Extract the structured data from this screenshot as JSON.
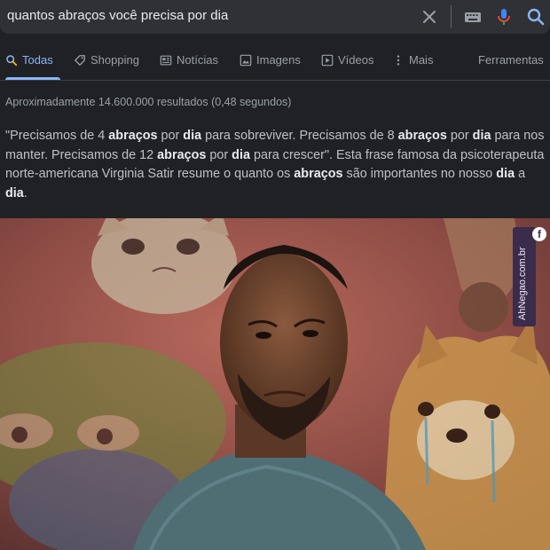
{
  "search": {
    "query": "quantos abraços você precisa por dia"
  },
  "tabs": [
    {
      "label": "Todas",
      "icon": "search-icon",
      "active": true
    },
    {
      "label": "Shopping",
      "icon": "tag-icon",
      "active": false
    },
    {
      "label": "Notícias",
      "icon": "news-icon",
      "active": false
    },
    {
      "label": "Imagens",
      "icon": "image-icon",
      "active": false
    },
    {
      "label": "Vídeos",
      "icon": "video-icon",
      "active": false
    },
    {
      "label": "Mais",
      "icon": "more-icon",
      "active": false
    }
  ],
  "tools_label": "Ferramentas",
  "result_stats": "Aproximadamente 14.600.000 resultados (0,48 segundos)",
  "snippet": [
    {
      "text": "\"Precisamos de 4 ",
      "bold": false
    },
    {
      "text": "abraços",
      "bold": true
    },
    {
      "text": " por ",
      "bold": false
    },
    {
      "text": "dia",
      "bold": true
    },
    {
      "text": " para sobreviver. Precisamos de 8 ",
      "bold": false
    },
    {
      "text": "abraços",
      "bold": true
    },
    {
      "text": " por ",
      "bold": false
    },
    {
      "text": "dia",
      "bold": true
    },
    {
      "text": " para nos manter. Precisamos de 12 ",
      "bold": false
    },
    {
      "text": "abraços",
      "bold": true
    },
    {
      "text": " por ",
      "bold": false
    },
    {
      "text": "dia",
      "bold": true
    },
    {
      "text": " para crescer\". Esta frase famosa da psicoterapeuta norte-americana Virginia Satir resume o quanto os ",
      "bold": false
    },
    {
      "text": "abraços",
      "bold": true
    },
    {
      "text": " são importantes no nosso ",
      "bold": false
    },
    {
      "text": "dia",
      "bold": true
    },
    {
      "text": " a ",
      "bold": false
    },
    {
      "text": "dia",
      "bold": true
    },
    {
      "text": ".",
      "bold": false
    }
  ],
  "watermark": {
    "text": "AhNegao.com.br",
    "badge": "f"
  },
  "colors": {
    "background": "#202124",
    "search_bar": "#303134",
    "accent_blue": "#8ab4f8",
    "mic_red": "#ea4335",
    "mic_blue": "#4285f4"
  }
}
